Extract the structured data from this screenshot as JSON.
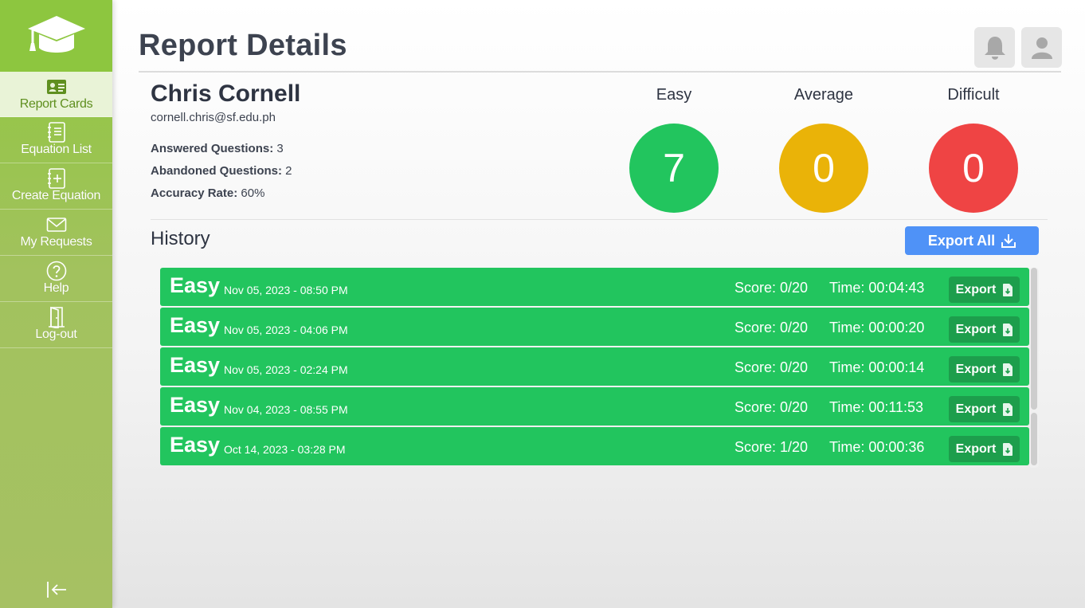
{
  "sidebar": {
    "logo_icon": "graduation-cap-icon",
    "items": [
      {
        "label": "Report Cards",
        "icon": "id-card-icon",
        "active": true
      },
      {
        "label": "Equation List",
        "icon": "notebook-list-icon",
        "active": false
      },
      {
        "label": "Create Equation",
        "icon": "notebook-plus-icon",
        "active": false
      },
      {
        "label": "My Requests",
        "icon": "envelope-icon",
        "active": false
      },
      {
        "label": "Help",
        "icon": "question-circle-icon",
        "active": false
      },
      {
        "label": "Log-out",
        "icon": "door-icon",
        "active": false
      }
    ],
    "collapse_icon": "collapse-left-icon"
  },
  "header": {
    "title": "Report Details",
    "bell_icon": "bell-icon",
    "user_icon": "user-icon"
  },
  "student": {
    "name": "Chris Cornell",
    "email": "cornell.chris@sf.edu.ph",
    "answered_label": "Answered Questions:",
    "answered_value": "3",
    "abandoned_label": "Abandoned Questions:",
    "abandoned_value": "2",
    "accuracy_label": "Accuracy Rate:",
    "accuracy_value": "60%"
  },
  "difficulty": [
    {
      "label": "Easy",
      "count": "7",
      "color": "#22c55e"
    },
    {
      "label": "Average",
      "count": "0",
      "color": "#eab308"
    },
    {
      "label": "Difficult",
      "count": "0",
      "color": "#ef4444"
    }
  ],
  "history": {
    "title": "History",
    "export_all_label": "Export All",
    "rows": [
      {
        "difficulty": "Easy",
        "date": "Nov 05, 2023 - 08:50 PM",
        "score": "Score: 0/20",
        "time": "Time: 00:04:43",
        "export_label": "Export"
      },
      {
        "difficulty": "Easy",
        "date": "Nov 05, 2023 - 04:06 PM",
        "score": "Score: 0/20",
        "time": "Time: 00:00:20",
        "export_label": "Export"
      },
      {
        "difficulty": "Easy",
        "date": "Nov 05, 2023 - 02:24 PM",
        "score": "Score: 0/20",
        "time": "Time: 00:00:14",
        "export_label": "Export"
      },
      {
        "difficulty": "Easy",
        "date": "Nov 04, 2023 - 08:55 PM",
        "score": "Score: 0/20",
        "time": "Time: 00:11:53",
        "export_label": "Export"
      },
      {
        "difficulty": "Easy",
        "date": "Oct 14, 2023 - 03:28 PM",
        "score": "Score: 1/20",
        "time": "Time: 00:00:36",
        "export_label": "Export"
      }
    ]
  }
}
